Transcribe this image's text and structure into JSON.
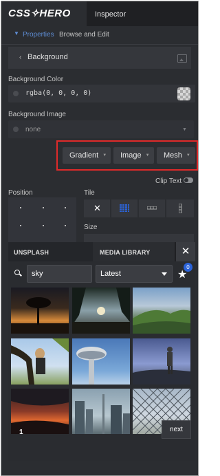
{
  "header": {
    "logo": "CSS✧HERO",
    "inspector_tab": "Inspector",
    "breadcrumb_arrow": "▼",
    "breadcrumb_properties": "Properties",
    "breadcrumb_browse": "Browse and Edit"
  },
  "background_panel": {
    "back_glyph": "‹",
    "title": "Background",
    "color_label": "Background Color",
    "color_value": "rgba(0, 0, 0, 0)",
    "image_label": "Background Image",
    "image_value": "none",
    "dropdown_caret": "▼"
  },
  "type_buttons": {
    "gradient": "Gradient",
    "image": "Image",
    "mesh": "Mesh",
    "caret": "▼"
  },
  "clip_text": {
    "label": "Clip Text",
    "enabled": false
  },
  "position": {
    "label": "Position"
  },
  "tile": {
    "label": "Tile",
    "none_glyph": "✕",
    "size_label": "Size"
  },
  "library": {
    "tab_unsplash": "UNSPLASH",
    "tab_media": "MEDIA LIBRARY",
    "close_glyph": "✕",
    "search_value": "sky",
    "sort_value": "Latest",
    "star_glyph": "★",
    "favorites_count": "0",
    "page_number": "1",
    "next_label": "next"
  },
  "colors": {
    "panel_bg": "#2b2d31",
    "top_bar": "#1f2023",
    "accent_link": "#5f8ed6",
    "highlight_border": "#e02a2a",
    "tile_active": "#2b63d9",
    "badge": "#2b63d9"
  },
  "icons": [
    "image-icon",
    "lock-icon",
    "checkerboard-swatch",
    "close-icon",
    "grid-icon",
    "repeat-x-icon",
    "repeat-y-icon",
    "search-icon",
    "star-icon"
  ]
}
